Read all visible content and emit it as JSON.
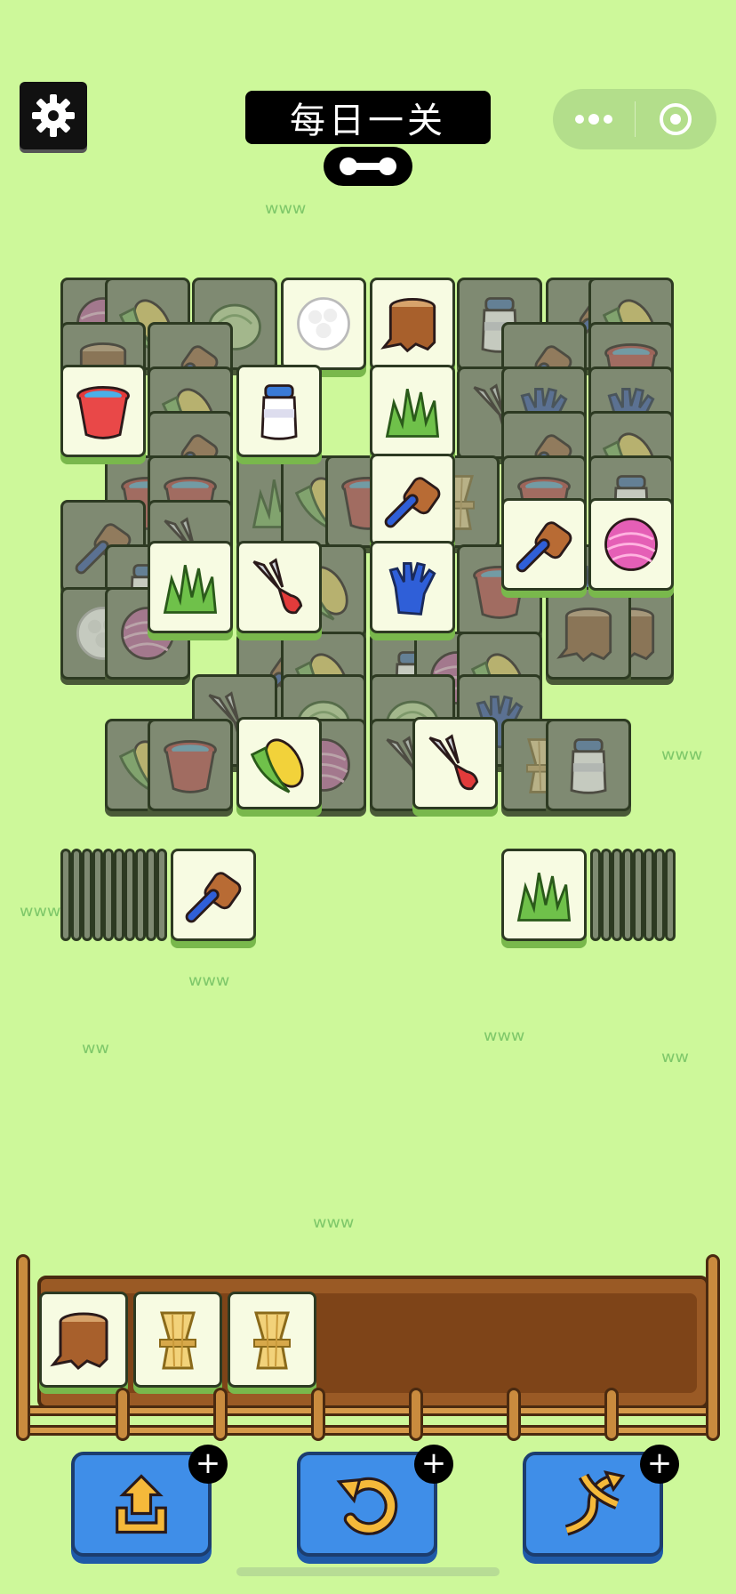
{
  "header": {
    "title": "每日一关",
    "settings_icon": "gear-icon",
    "progress_icon": "progress-bone-icon",
    "menu_icons": [
      "more-dots-icon",
      "target-circle-icon"
    ]
  },
  "board": {
    "colors": {
      "bg": "#cdf89a",
      "tile_face": "#f7fbe2",
      "tile_blocked": "#7f8a72",
      "tile_shadow": "#79b84c"
    },
    "free_tiles": [
      "stump",
      "cauliflower",
      "bucket",
      "milk",
      "grass",
      "brush",
      "brush",
      "yarn",
      "grass",
      "shears",
      "glove",
      "corn",
      "shears"
    ],
    "left_stack_top": "brush",
    "right_stack_top": "grass"
  },
  "tray": {
    "slots": [
      "stump",
      "wheat",
      "wheat"
    ],
    "capacity": 7
  },
  "powerups": [
    {
      "name": "move-out",
      "icon": "move-out-icon",
      "badge": "+"
    },
    {
      "name": "undo",
      "icon": "undo-icon",
      "badge": "+"
    },
    {
      "name": "shuffle",
      "icon": "shuffle-icon",
      "badge": "+"
    }
  ]
}
